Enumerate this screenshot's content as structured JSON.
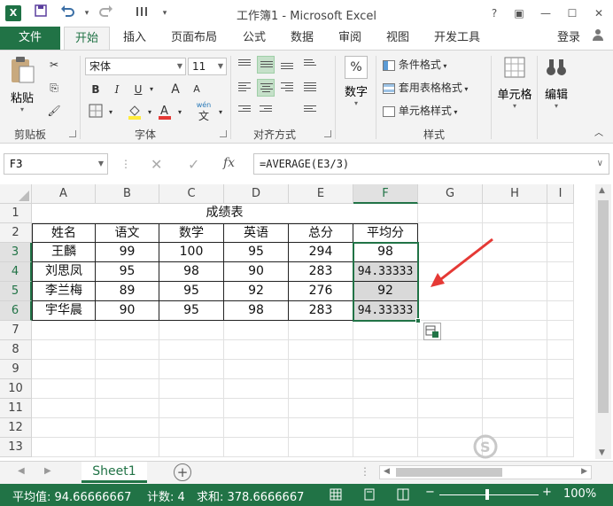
{
  "window": {
    "title": "工作簿1 - Microsoft Excel",
    "logo": "X",
    "help": "?",
    "restore_icon": "▣",
    "minimize": "—",
    "maximize": "☐",
    "close": "✕"
  },
  "quick_access": {
    "save_icon": "save-icon",
    "undo_icon": "undo-icon",
    "redo_icon": "redo-icon",
    "customize_icon": "customize-icon"
  },
  "tabs": [
    "文件",
    "开始",
    "插入",
    "页面布局",
    "公式",
    "数据",
    "审阅",
    "视图",
    "开发工具"
  ],
  "login": "登录",
  "ribbon": {
    "clipboard": {
      "paste": "粘贴",
      "label": "剪贴板"
    },
    "font": {
      "name": "宋体",
      "size": "11",
      "bold": "B",
      "italic": "I",
      "underline": "U",
      "grow": "A",
      "shrink": "A",
      "label": "字体",
      "wen": "wén",
      "wen_char": "文"
    },
    "alignment": {
      "label": "对齐方式"
    },
    "number": {
      "label": "数字",
      "pct": "%"
    },
    "styles": {
      "cond": "条件格式",
      "table": "套用表格格式",
      "cell": "单元格样式",
      "label": "样式"
    },
    "cells": {
      "label": "单元格"
    },
    "editing": {
      "label": "编辑"
    }
  },
  "formula_bar": {
    "name_box": "F3",
    "fx": "fx",
    "formula": "=AVERAGE(E3/3)"
  },
  "columns": [
    "A",
    "B",
    "C",
    "D",
    "E",
    "F",
    "G",
    "H",
    "I"
  ],
  "rows": [
    "1",
    "2",
    "3",
    "4",
    "5",
    "6",
    "7",
    "8",
    "9",
    "10",
    "11",
    "12",
    "13"
  ],
  "sheet": {
    "title": "成绩表",
    "headers": [
      "姓名",
      "语文",
      "数学",
      "英语",
      "总分",
      "平均分"
    ],
    "data": [
      [
        "王麟",
        "99",
        "100",
        "95",
        "294",
        "98"
      ],
      [
        "刘思凤",
        "95",
        "98",
        "90",
        "283",
        "94.33333"
      ],
      [
        "李兰梅",
        "89",
        "95",
        "92",
        "276",
        "92"
      ],
      [
        "宇华晨",
        "90",
        "95",
        "98",
        "283",
        "94.33333"
      ]
    ]
  },
  "sheet_tabs": {
    "active": "Sheet1",
    "add": "+"
  },
  "status": {
    "average": "平均值: 94.66666667",
    "count": "计数: 4",
    "sum": "求和: 378.6666667",
    "zoom": "100%"
  },
  "colors": {
    "excel_green": "#217346",
    "arrow_red": "#e53935"
  }
}
